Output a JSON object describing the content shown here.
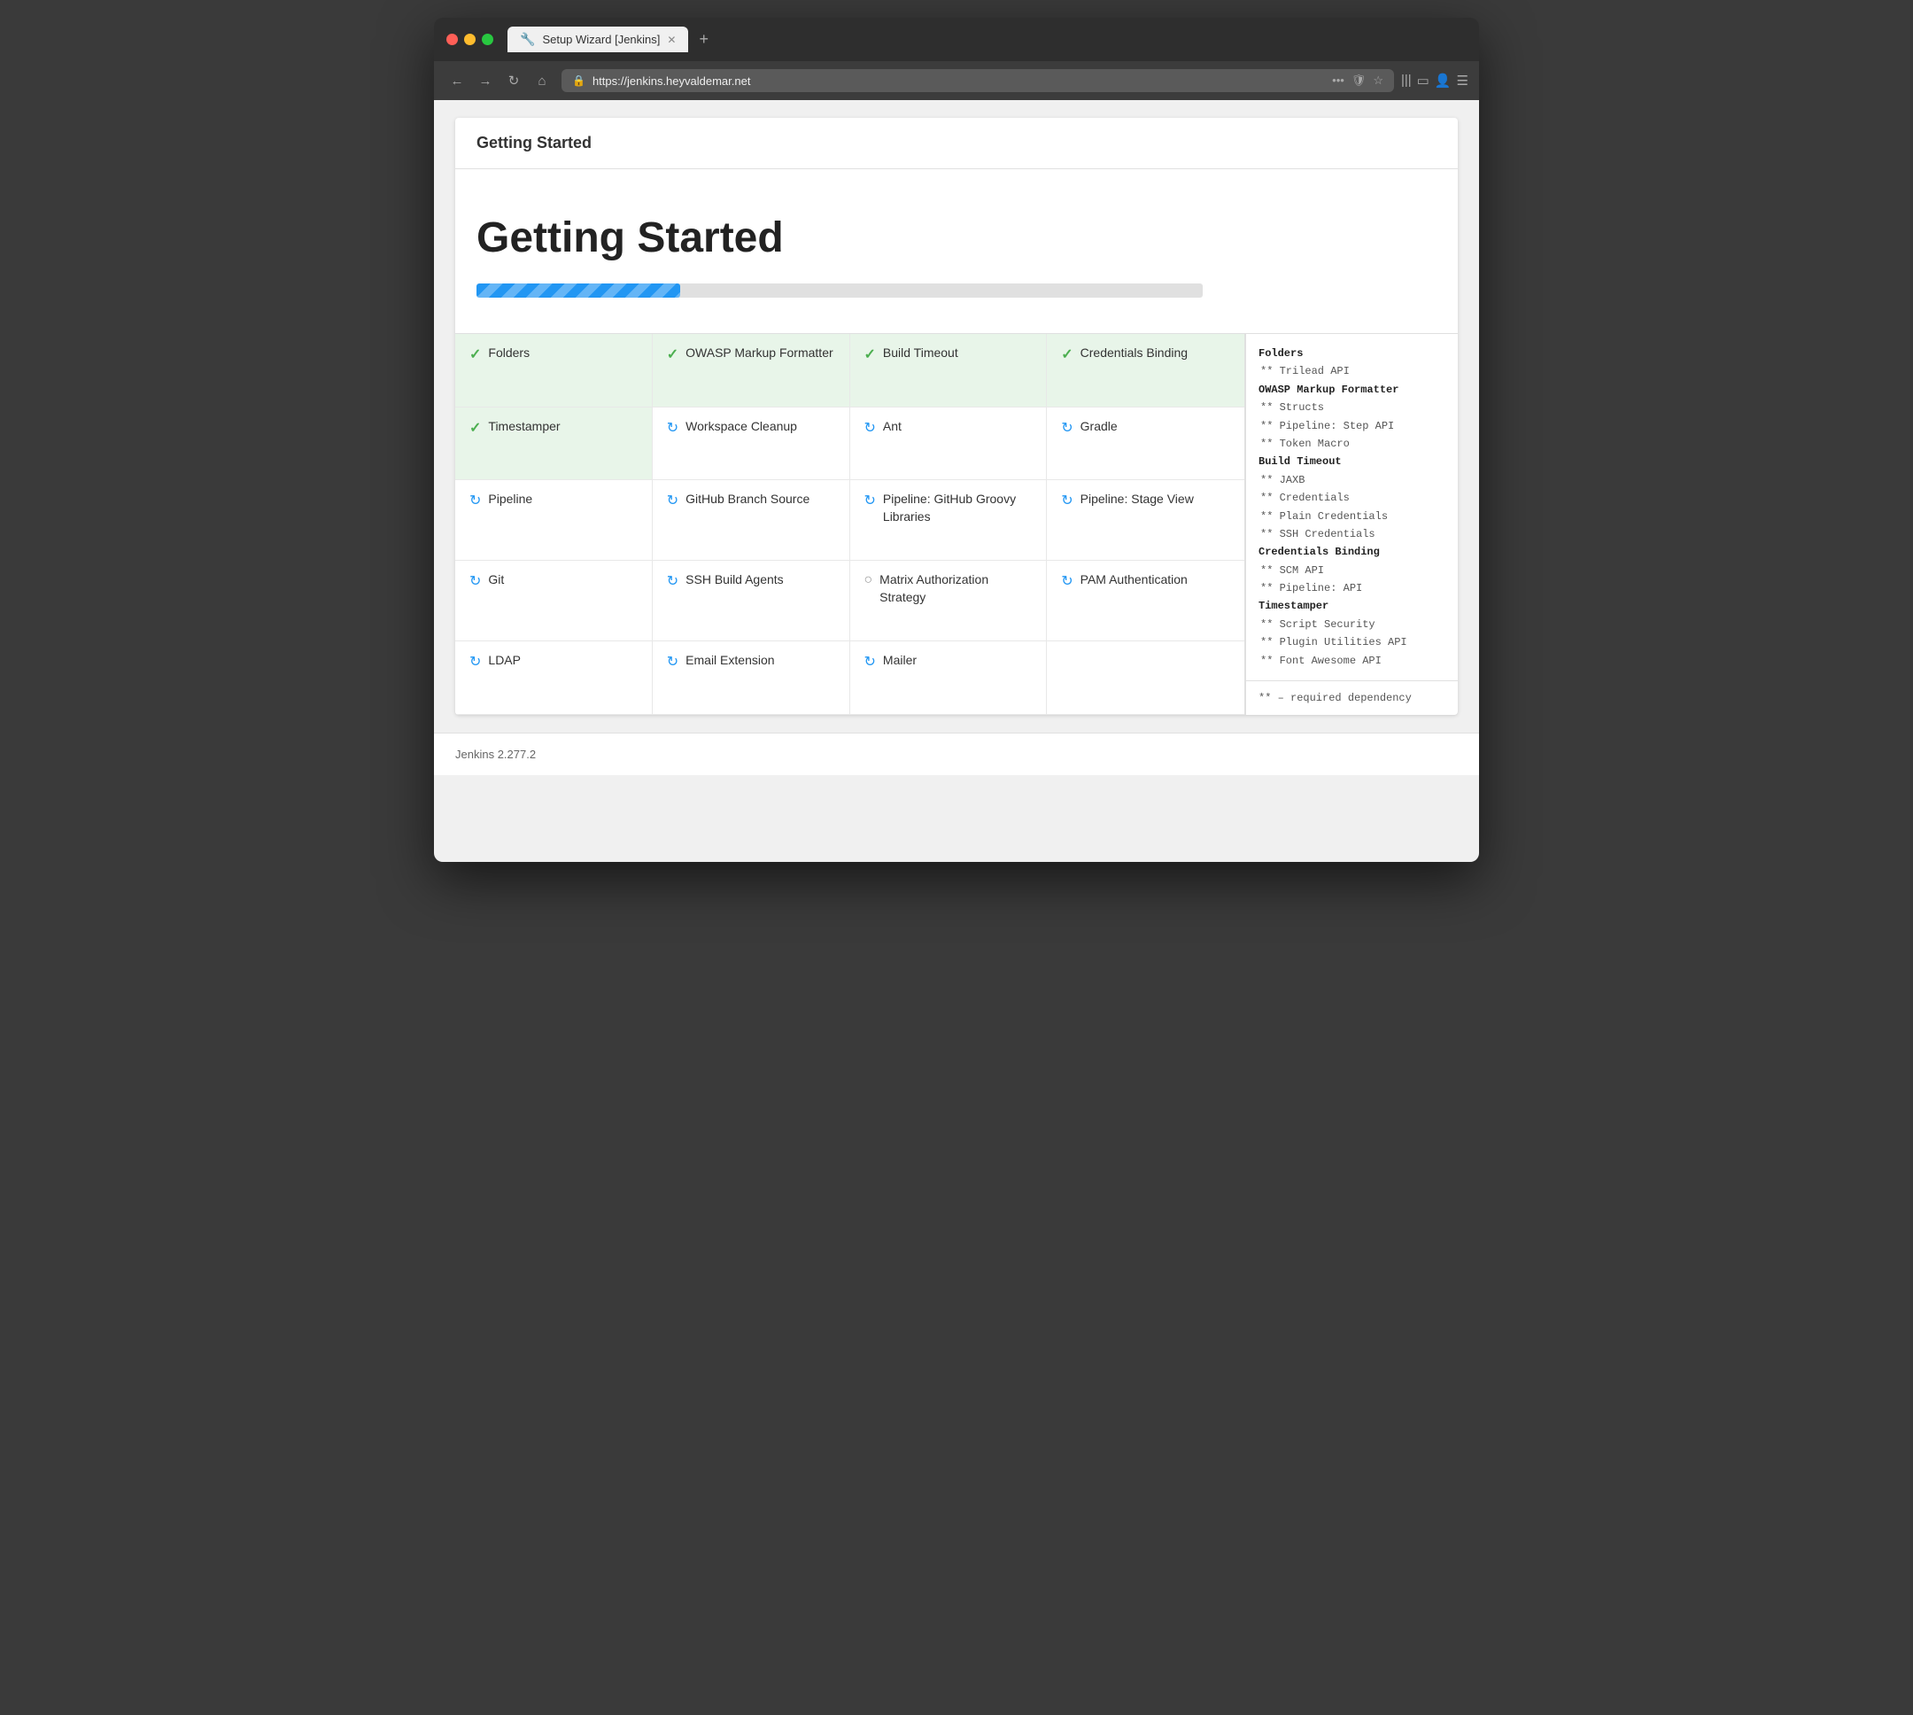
{
  "browser": {
    "tab_title": "Setup Wizard [Jenkins]",
    "url": "https://jenkins.heyvaldemar.net",
    "new_tab_label": "+",
    "close_tab_label": "✕"
  },
  "page": {
    "card_header": "Getting Started",
    "hero_title": "Getting Started",
    "progress_percent": 28
  },
  "plugins": [
    {
      "name": "Folders",
      "status": "check",
      "row": 0,
      "col": 0
    },
    {
      "name": "OWASP Markup Formatter",
      "status": "check",
      "row": 0,
      "col": 1
    },
    {
      "name": "Build Timeout",
      "status": "check",
      "row": 0,
      "col": 2
    },
    {
      "name": "Credentials Binding",
      "status": "check",
      "row": 0,
      "col": 3
    },
    {
      "name": "Timestamper",
      "status": "check",
      "row": 1,
      "col": 0
    },
    {
      "name": "Workspace Cleanup",
      "status": "spin",
      "row": 1,
      "col": 1
    },
    {
      "name": "Ant",
      "status": "spin",
      "row": 1,
      "col": 2
    },
    {
      "name": "Gradle",
      "status": "spin",
      "row": 1,
      "col": 3
    },
    {
      "name": "Pipeline",
      "status": "spin",
      "row": 2,
      "col": 0
    },
    {
      "name": "GitHub Branch Source",
      "status": "spin",
      "row": 2,
      "col": 1
    },
    {
      "name": "Pipeline: GitHub Groovy Libraries",
      "status": "spin",
      "row": 2,
      "col": 2
    },
    {
      "name": "Pipeline: Stage View",
      "status": "spin",
      "row": 2,
      "col": 3
    },
    {
      "name": "Git",
      "status": "spin",
      "row": 3,
      "col": 0
    },
    {
      "name": "SSH Build Agents",
      "status": "spin",
      "row": 3,
      "col": 1
    },
    {
      "name": "Matrix Authorization Strategy",
      "status": "circle",
      "row": 3,
      "col": 2
    },
    {
      "name": "PAM Authentication",
      "status": "spin",
      "row": 3,
      "col": 3
    },
    {
      "name": "LDAP",
      "status": "spin",
      "row": 4,
      "col": 0
    },
    {
      "name": "Email Extension",
      "status": "spin",
      "row": 4,
      "col": 1
    },
    {
      "name": "Mailer",
      "status": "spin",
      "row": 4,
      "col": 2
    }
  ],
  "dependencies": [
    {
      "type": "group",
      "text": "Folders"
    },
    {
      "type": "dep",
      "text": "** Trilead API"
    },
    {
      "type": "group",
      "text": "OWASP Markup Formatter"
    },
    {
      "type": "dep",
      "text": "** Structs"
    },
    {
      "type": "dep",
      "text": "** Pipeline: Step API"
    },
    {
      "type": "dep",
      "text": "** Token Macro"
    },
    {
      "type": "group",
      "text": "Build Timeout"
    },
    {
      "type": "dep",
      "text": "** JAXB"
    },
    {
      "type": "dep",
      "text": "** Credentials"
    },
    {
      "type": "dep",
      "text": "** Plain Credentials"
    },
    {
      "type": "dep",
      "text": "** SSH Credentials"
    },
    {
      "type": "group",
      "text": "Credentials Binding"
    },
    {
      "type": "dep",
      "text": "** SCM API"
    },
    {
      "type": "dep",
      "text": "** Pipeline: API"
    },
    {
      "type": "group",
      "text": "Timestamper"
    },
    {
      "type": "dep",
      "text": "** Script Security"
    },
    {
      "type": "dep",
      "text": "** Plugin Utilities API"
    },
    {
      "type": "dep",
      "text": "** Font Awesome API"
    }
  ],
  "dep_footer": "** – required dependency",
  "footer": {
    "version": "Jenkins 2.277.2"
  }
}
